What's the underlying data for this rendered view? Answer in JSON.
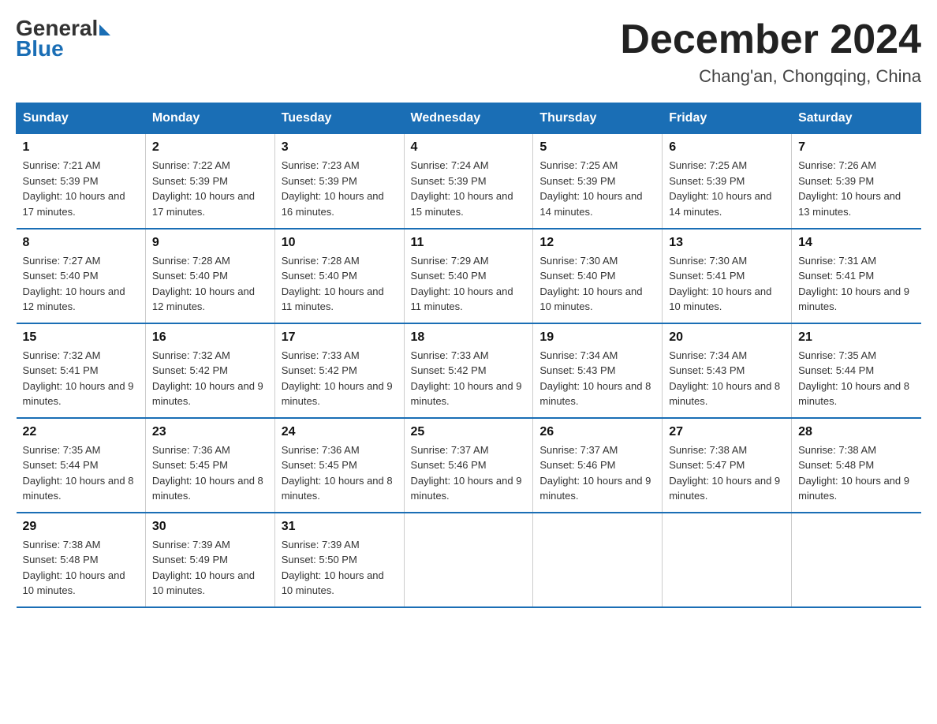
{
  "logo": {
    "general": "General",
    "blue": "Blue"
  },
  "header": {
    "month": "December 2024",
    "location": "Chang'an, Chongqing, China"
  },
  "weekdays": [
    "Sunday",
    "Monday",
    "Tuesday",
    "Wednesday",
    "Thursday",
    "Friday",
    "Saturday"
  ],
  "weeks": [
    [
      {
        "day": "1",
        "sunrise": "7:21 AM",
        "sunset": "5:39 PM",
        "daylight": "10 hours and 17 minutes."
      },
      {
        "day": "2",
        "sunrise": "7:22 AM",
        "sunset": "5:39 PM",
        "daylight": "10 hours and 17 minutes."
      },
      {
        "day": "3",
        "sunrise": "7:23 AM",
        "sunset": "5:39 PM",
        "daylight": "10 hours and 16 minutes."
      },
      {
        "day": "4",
        "sunrise": "7:24 AM",
        "sunset": "5:39 PM",
        "daylight": "10 hours and 15 minutes."
      },
      {
        "day": "5",
        "sunrise": "7:25 AM",
        "sunset": "5:39 PM",
        "daylight": "10 hours and 14 minutes."
      },
      {
        "day": "6",
        "sunrise": "7:25 AM",
        "sunset": "5:39 PM",
        "daylight": "10 hours and 14 minutes."
      },
      {
        "day": "7",
        "sunrise": "7:26 AM",
        "sunset": "5:39 PM",
        "daylight": "10 hours and 13 minutes."
      }
    ],
    [
      {
        "day": "8",
        "sunrise": "7:27 AM",
        "sunset": "5:40 PM",
        "daylight": "10 hours and 12 minutes."
      },
      {
        "day": "9",
        "sunrise": "7:28 AM",
        "sunset": "5:40 PM",
        "daylight": "10 hours and 12 minutes."
      },
      {
        "day": "10",
        "sunrise": "7:28 AM",
        "sunset": "5:40 PM",
        "daylight": "10 hours and 11 minutes."
      },
      {
        "day": "11",
        "sunrise": "7:29 AM",
        "sunset": "5:40 PM",
        "daylight": "10 hours and 11 minutes."
      },
      {
        "day": "12",
        "sunrise": "7:30 AM",
        "sunset": "5:40 PM",
        "daylight": "10 hours and 10 minutes."
      },
      {
        "day": "13",
        "sunrise": "7:30 AM",
        "sunset": "5:41 PM",
        "daylight": "10 hours and 10 minutes."
      },
      {
        "day": "14",
        "sunrise": "7:31 AM",
        "sunset": "5:41 PM",
        "daylight": "10 hours and 9 minutes."
      }
    ],
    [
      {
        "day": "15",
        "sunrise": "7:32 AM",
        "sunset": "5:41 PM",
        "daylight": "10 hours and 9 minutes."
      },
      {
        "day": "16",
        "sunrise": "7:32 AM",
        "sunset": "5:42 PM",
        "daylight": "10 hours and 9 minutes."
      },
      {
        "day": "17",
        "sunrise": "7:33 AM",
        "sunset": "5:42 PM",
        "daylight": "10 hours and 9 minutes."
      },
      {
        "day": "18",
        "sunrise": "7:33 AM",
        "sunset": "5:42 PM",
        "daylight": "10 hours and 9 minutes."
      },
      {
        "day": "19",
        "sunrise": "7:34 AM",
        "sunset": "5:43 PM",
        "daylight": "10 hours and 8 minutes."
      },
      {
        "day": "20",
        "sunrise": "7:34 AM",
        "sunset": "5:43 PM",
        "daylight": "10 hours and 8 minutes."
      },
      {
        "day": "21",
        "sunrise": "7:35 AM",
        "sunset": "5:44 PM",
        "daylight": "10 hours and 8 minutes."
      }
    ],
    [
      {
        "day": "22",
        "sunrise": "7:35 AM",
        "sunset": "5:44 PM",
        "daylight": "10 hours and 8 minutes."
      },
      {
        "day": "23",
        "sunrise": "7:36 AM",
        "sunset": "5:45 PM",
        "daylight": "10 hours and 8 minutes."
      },
      {
        "day": "24",
        "sunrise": "7:36 AM",
        "sunset": "5:45 PM",
        "daylight": "10 hours and 8 minutes."
      },
      {
        "day": "25",
        "sunrise": "7:37 AM",
        "sunset": "5:46 PM",
        "daylight": "10 hours and 9 minutes."
      },
      {
        "day": "26",
        "sunrise": "7:37 AM",
        "sunset": "5:46 PM",
        "daylight": "10 hours and 9 minutes."
      },
      {
        "day": "27",
        "sunrise": "7:38 AM",
        "sunset": "5:47 PM",
        "daylight": "10 hours and 9 minutes."
      },
      {
        "day": "28",
        "sunrise": "7:38 AM",
        "sunset": "5:48 PM",
        "daylight": "10 hours and 9 minutes."
      }
    ],
    [
      {
        "day": "29",
        "sunrise": "7:38 AM",
        "sunset": "5:48 PM",
        "daylight": "10 hours and 10 minutes."
      },
      {
        "day": "30",
        "sunrise": "7:39 AM",
        "sunset": "5:49 PM",
        "daylight": "10 hours and 10 minutes."
      },
      {
        "day": "31",
        "sunrise": "7:39 AM",
        "sunset": "5:50 PM",
        "daylight": "10 hours and 10 minutes."
      },
      null,
      null,
      null,
      null
    ]
  ]
}
